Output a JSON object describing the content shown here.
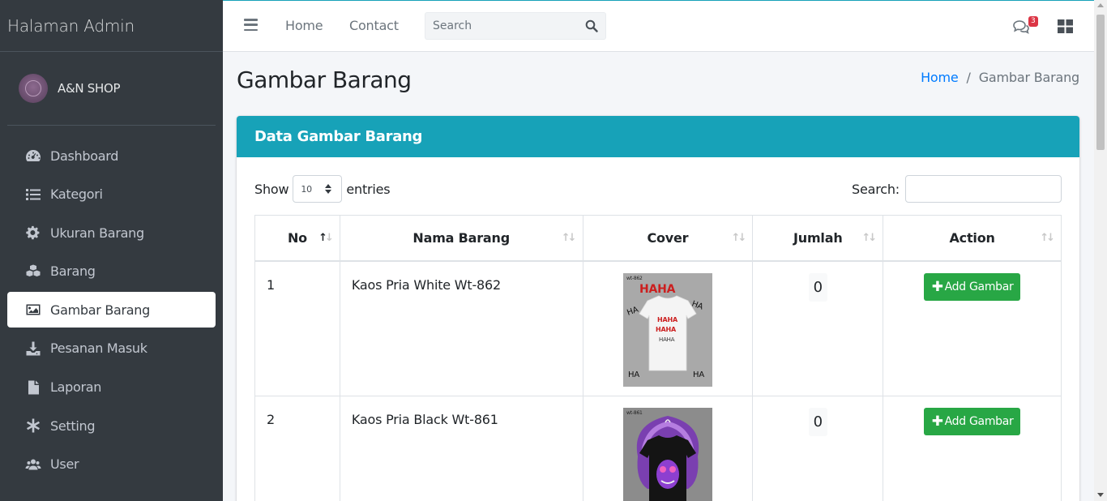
{
  "sidebar": {
    "brand": "Halaman Admin",
    "user_name": "A&N SHOP",
    "items": [
      {
        "label": "Dashboard",
        "icon": "dashboard-icon"
      },
      {
        "label": "Kategori",
        "icon": "list-icon"
      },
      {
        "label": "Ukuran Barang",
        "icon": "gear-icon"
      },
      {
        "label": "Barang",
        "icon": "cubes-icon"
      },
      {
        "label": "Gambar Barang",
        "icon": "image-icon",
        "active": true
      },
      {
        "label": "Pesanan Masuk",
        "icon": "download-icon"
      },
      {
        "label": "Laporan",
        "icon": "file-icon"
      },
      {
        "label": "Setting",
        "icon": "asterisk-icon"
      },
      {
        "label": "User",
        "icon": "users-icon"
      }
    ]
  },
  "navbar": {
    "links": [
      "Home",
      "Contact"
    ],
    "search_placeholder": "Search",
    "messages_badge": "3"
  },
  "content": {
    "page_title": "Gambar Barang",
    "breadcrumb": {
      "home": "Home",
      "separator": "/",
      "current": "Gambar Barang"
    },
    "card_title": "Data Gambar Barang",
    "show_label": "Show",
    "entries_value": "10",
    "entries_label": "entries",
    "search_label": "Search:"
  },
  "table": {
    "headers": [
      "No",
      "Nama Barang",
      "Cover",
      "Jumlah",
      "Action"
    ],
    "rows": [
      {
        "no": "1",
        "nama": "Kaos Pria White Wt-862",
        "jumlah": "0",
        "action": "Add Gambar"
      },
      {
        "no": "2",
        "nama": "Kaos Pria Black Wt-861",
        "jumlah": "0",
        "action": "Add Gambar"
      }
    ]
  },
  "colors": {
    "sidebar_bg": "#343a40",
    "card_header": "#17a2b8",
    "button_green": "#28a745",
    "link_blue": "#007bff",
    "badge_red": "#dc3545"
  }
}
